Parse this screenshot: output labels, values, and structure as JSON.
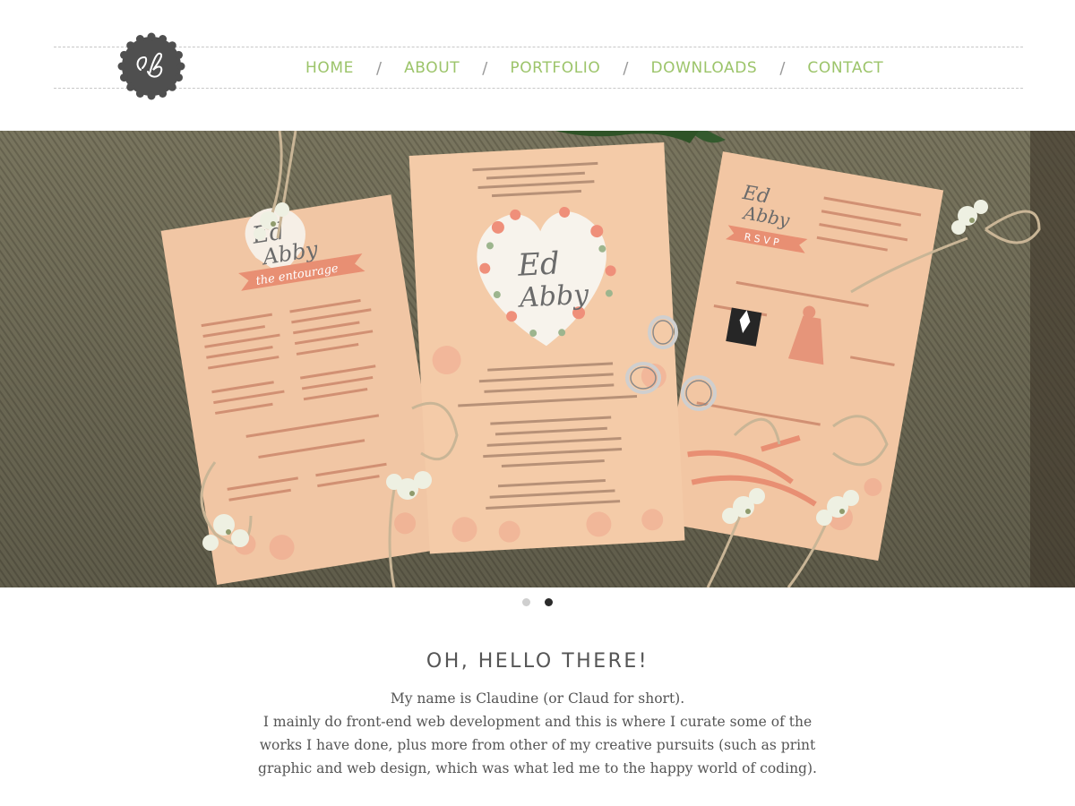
{
  "logo": {
    "monogram": "cb",
    "icon": "monogram-badge-icon"
  },
  "nav": {
    "items": [
      {
        "label": "HOME"
      },
      {
        "label": "ABOUT"
      },
      {
        "label": "PORTFOLIO"
      },
      {
        "label": "DOWNLOADS"
      },
      {
        "label": "CONTACT"
      }
    ],
    "separator": "/"
  },
  "slider": {
    "image": "wedding-invitation-suite-photo",
    "invite_names": [
      "Ed",
      "Abby"
    ],
    "entourage_banner": "the entourage",
    "rsvp_banner": "R S V P",
    "slide_count": 2,
    "active_slide": 2
  },
  "intro": {
    "heading": "OH, HELLO THERE!",
    "line1": "My name is Claudine (or Claud for short).",
    "line2": "I mainly do front-end web development and this is where I curate some of the",
    "line3": "works I have done, plus more from other of my creative pursuits (such as print",
    "line4": "graphic and web design, which was what led me to the happy world of coding)."
  },
  "colors": {
    "accent_green": "#9cc46a",
    "text_gray": "#555555",
    "logo_gray": "#4f4f4f",
    "card_peach": "#f3c9a6"
  }
}
